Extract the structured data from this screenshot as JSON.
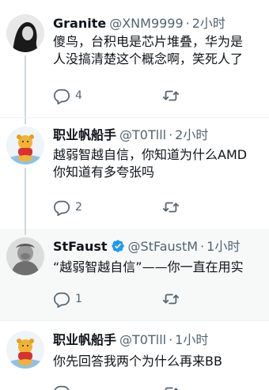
{
  "tweets": [
    {
      "name": "Granite",
      "handle": "@XNM9999",
      "time": "2小时",
      "lines": [
        "傻鸟，台积电是芯片堆叠，华为是",
        "人没搞清楚这个概念啊，笑死人了"
      ],
      "reply_count": "4",
      "verified": false
    },
    {
      "name": "职业帆船手",
      "handle": "@T0Tlll",
      "time": "2小时",
      "lines": [
        "越弱智越自信，你知道为什么AMD",
        "你知道有多夸张吗"
      ],
      "reply_count": "2",
      "verified": false
    },
    {
      "name": "StFaust",
      "handle": "@StFaustM",
      "time": "1小时",
      "lines": [
        "“越弱智越自信”——你一直在用实"
      ],
      "reply_count": "1",
      "verified": true
    },
    {
      "name": "职业帆船手",
      "handle": "@T0Tlll",
      "time": "1小时",
      "lines": [
        "你先回答我两个为什么再来BB"
      ],
      "reply_count": "",
      "verified": false
    }
  ],
  "separator": "·",
  "colors": {
    "text": "#0f1419",
    "muted": "#536471",
    "verified": "#1d9bf0",
    "line": "#cfd9de"
  },
  "icons": {
    "reply": "reply-icon",
    "retweet": "retweet-icon",
    "verified": "verified-badge-icon"
  }
}
